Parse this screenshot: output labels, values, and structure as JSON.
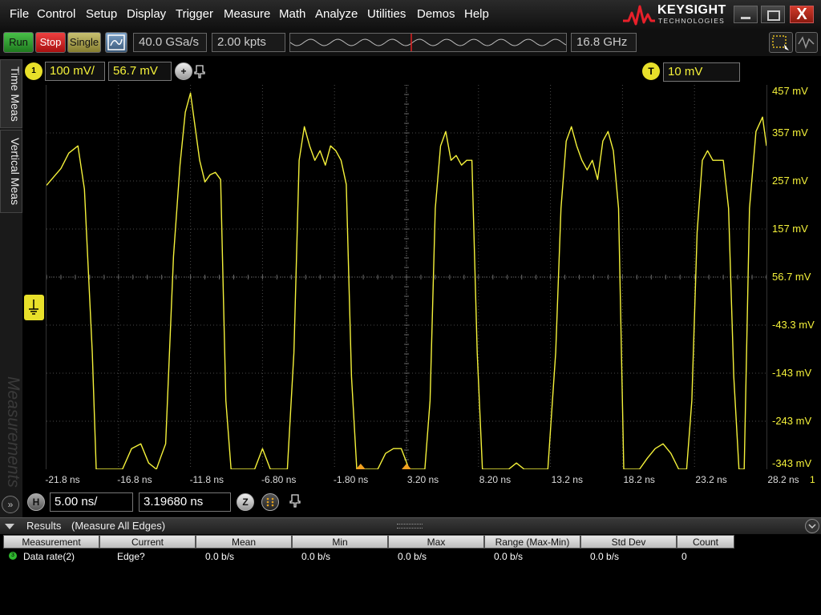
{
  "menu": [
    "File",
    "Control",
    "Setup",
    "Display",
    "Trigger",
    "Measure",
    "Math",
    "Analyze",
    "Utilities",
    "Demos",
    "Help"
  ],
  "logo": {
    "brand": "KEYSIGHT",
    "sub": "TECHNOLOGIES"
  },
  "window": {
    "close_label": "X"
  },
  "toolbar": {
    "run_label": "Run",
    "stop_label": "Stop",
    "single_label": "Single",
    "sample_rate": "40.0 GSa/s",
    "memory_depth": "2.00 kpts",
    "bandwidth": "16.8 GHz",
    "trigger_badge": "T",
    "trigger_level": "10 mV"
  },
  "tabs": {
    "time": "Time Meas",
    "vertical": "Vertical Meas",
    "watermark": "Measurements"
  },
  "channel": {
    "badge": "1",
    "scale": "100 mV/",
    "offset": "56.7 mV",
    "add_label": "+"
  },
  "y_axis_labels": [
    "457 mV",
    "357 mV",
    "257 mV",
    "157 mV",
    "56.7 mV",
    "-43.3 mV",
    "-143 mV",
    "-243 mV",
    "-343 mV"
  ],
  "x_axis_labels": [
    "-21.8 ns",
    "-16.8 ns",
    "-11.8 ns",
    "-6.80 ns",
    "-1.80 ns",
    "3.20 ns",
    "8.20 ns",
    "13.2 ns",
    "18.2 ns",
    "23.2 ns",
    "28.2 ns"
  ],
  "x_axis_channel_marker": "1",
  "horizontal": {
    "badge": "H",
    "scale": "5.00 ns/",
    "position": "3.19680 ns",
    "zoom_label": "Z"
  },
  "results": {
    "title": "Results",
    "subtitle": "(Measure All Edges)",
    "columns": [
      "Measurement",
      "Current",
      "Mean",
      "Min",
      "Max",
      "Range (Max-Min)",
      "Std Dev",
      "Count"
    ],
    "rows": [
      {
        "badge": "3",
        "cells": [
          "Data rate(2)",
          "Edge?",
          "0.0 b/s",
          "0.0 b/s",
          "0.0 b/s",
          "0.0 b/s",
          "0.0 b/s",
          "0"
        ]
      }
    ]
  },
  "colors": {
    "trace": "#f5f23a",
    "grid": "#4a4a4a",
    "run": "#2faa2f",
    "stop": "#d42020"
  },
  "chart_data": {
    "type": "line",
    "x_unit": "ns",
    "y_unit": "mV",
    "xlim": [
      -24.3,
      30.7
    ],
    "ylim": [
      -343,
      457
    ],
    "grid": true,
    "x": [
      -24.3,
      -23.2,
      -22.6,
      -21.9,
      -21.4,
      -20.8,
      -20.5,
      -20.1,
      -19.7,
      -19.2,
      -18.5,
      -17.8,
      -17.1,
      -16.5,
      -15.9,
      -15.6,
      -15.2,
      -14.6,
      -14.1,
      -13.7,
      -13.3,
      -13.0,
      -12.6,
      -12.2,
      -11.8,
      -11.4,
      -11.0,
      -10.6,
      -10.2,
      -9.8,
      -9.4,
      -9.0,
      -8.4,
      -7.8,
      -7.2,
      -6.5,
      -5.9,
      -5.4,
      -5.0,
      -4.6,
      -4.2,
      -3.8,
      -3.4,
      -3.0,
      -2.6,
      -2.2,
      -1.8,
      -1.4,
      -1.0,
      -0.6,
      -0.2,
      0.4,
      1.0,
      1.6,
      2.2,
      2.8,
      3.4,
      4.0,
      4.6,
      5.0,
      5.4,
      5.8,
      6.2,
      6.6,
      7.0,
      7.4,
      7.8,
      8.2,
      8.6,
      9.0,
      9.4,
      9.8,
      10.4,
      11.0,
      11.6,
      12.2,
      12.8,
      13.4,
      14.0,
      14.6,
      15.0,
      15.4,
      15.8,
      16.2,
      16.6,
      17.0,
      17.4,
      17.8,
      18.2,
      18.6,
      19.0,
      19.4,
      19.8,
      20.4,
      21.0,
      21.6,
      22.2,
      22.8,
      23.4,
      24.0,
      24.6,
      25.0,
      25.4,
      25.8,
      26.2,
      26.6,
      27.0,
      27.4,
      27.8,
      28.2,
      28.6,
      29.0,
      29.4,
      29.9,
      30.4,
      30.7
    ],
    "y": [
      248,
      283,
      315,
      330,
      240,
      -100,
      -343,
      -343,
      -343,
      -343,
      -343,
      -300,
      -290,
      -330,
      -343,
      -320,
      -290,
      100,
      290,
      400,
      440,
      380,
      300,
      255,
      270,
      275,
      260,
      -200,
      -343,
      -343,
      -343,
      -343,
      -343,
      -300,
      -343,
      -343,
      -343,
      -100,
      300,
      370,
      330,
      300,
      320,
      290,
      330,
      320,
      300,
      250,
      -150,
      -343,
      -343,
      -343,
      -343,
      -310,
      -300,
      -300,
      -343,
      -343,
      -343,
      -200,
      200,
      330,
      360,
      300,
      310,
      290,
      300,
      300,
      -100,
      -343,
      -343,
      -343,
      -343,
      -343,
      -330,
      -343,
      -343,
      -343,
      -343,
      -100,
      200,
      340,
      370,
      330,
      300,
      280,
      300,
      260,
      340,
      360,
      320,
      200,
      -343,
      -343,
      -343,
      -320,
      -300,
      -290,
      -310,
      -343,
      -343,
      -200,
      150,
      300,
      320,
      300,
      300,
      300,
      200,
      -150,
      -343,
      -343,
      200,
      360,
      390,
      330,
      320
    ]
  }
}
